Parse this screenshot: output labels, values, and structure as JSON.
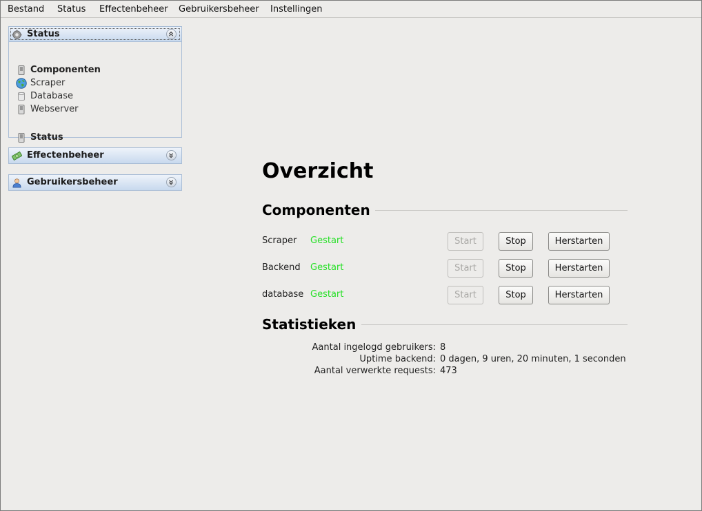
{
  "menu": [
    "Bestand",
    "Status",
    "Effectenbeheer",
    "Gebruikersbeheer",
    "Instellingen"
  ],
  "sidebar": {
    "status_panel": {
      "title": "Status",
      "items": [
        {
          "label": "Componenten",
          "bold": true,
          "icon": "server-icon"
        },
        {
          "label": "Scraper",
          "bold": false,
          "icon": "globe-icon"
        },
        {
          "label": "Database",
          "bold": false,
          "icon": "database-icon"
        },
        {
          "label": "Webserver",
          "bold": false,
          "icon": "server-icon"
        },
        {
          "label": "Status",
          "bold": true,
          "icon": "server-icon"
        }
      ]
    },
    "effecten_panel": {
      "title": "Effectenbeheer",
      "icon": "money-icon"
    },
    "gebruikers_panel": {
      "title": "Gebruikersbeheer",
      "icon": "user-icon"
    }
  },
  "main": {
    "title": "Overzicht",
    "components_heading": "Componenten",
    "components": [
      {
        "name": "Scraper",
        "status": "Gestart"
      },
      {
        "name": "Backend",
        "status": "Gestart"
      },
      {
        "name": "database",
        "status": "Gestart"
      }
    ],
    "buttons": {
      "start": "Start",
      "stop": "Stop",
      "restart": "Herstarten"
    },
    "statistics_heading": "Statistieken",
    "statistics": [
      {
        "label": "Aantal ingelogd gebruikers:",
        "value": "8"
      },
      {
        "label": "Uptime backend:",
        "value": "0 dagen, 9 uren, 20 minuten, 1 seconden"
      },
      {
        "label": "Aantal verwerkte requests:",
        "value": "473"
      }
    ]
  },
  "colors": {
    "status_ok": "#28e028",
    "panel_header": "#c8d9ee"
  }
}
